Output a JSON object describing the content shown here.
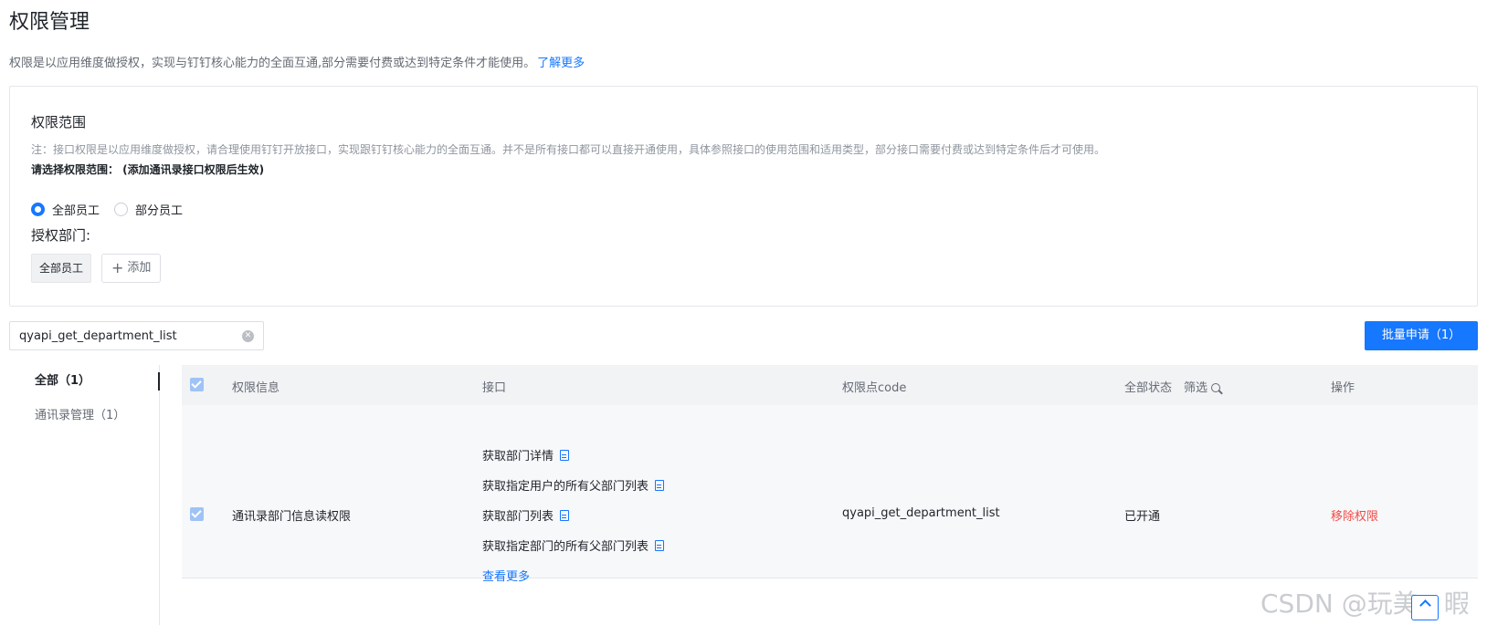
{
  "page": {
    "title": "权限管理",
    "intro": "权限是以应用维度做授权，实现与钉钉核心能力的全面互通,部分需要付费或达到特定条件才能使用。",
    "learn_more": "了解更多"
  },
  "scope": {
    "title": "权限范围",
    "note": "注：接口权限是以应用维度做授权，请合理使用钉钉开放接口，实现跟钉钉核心能力的全面互通。并不是所有接口都可以直接开通使用，具体参照接口的使用范围和适用类型，部分接口需要付费或达到特定条件后才可使用。",
    "select_label": "请选择权限范围： (添加通讯录接口权限后生效)",
    "options": [
      {
        "label": "全部员工",
        "checked": true
      },
      {
        "label": "部分员工",
        "checked": false
      }
    ],
    "dept_label": "授权部门:",
    "dept_tag": "全部员工",
    "add_label": "添加"
  },
  "search": {
    "value": "qyapi_get_department_list",
    "placeholder": ""
  },
  "batch_button": "批量申请（1）",
  "side_nav": [
    {
      "label": "全部（1）",
      "active": true
    },
    {
      "label": "通讯录管理（1）",
      "active": false
    }
  ],
  "table": {
    "headers": {
      "info": "权限信息",
      "api": "接口",
      "code": "权限点code",
      "status": "全部状态",
      "filter": "筛选",
      "action": "操作"
    },
    "rows": [
      {
        "name": "通讯录部门信息读权限",
        "apis": [
          "获取部门详情",
          "获取指定用户的所有父部门列表",
          "获取部门列表",
          "获取指定部门的所有父部门列表"
        ],
        "more": "查看更多",
        "code": "qyapi_get_department_list",
        "status": "已开通",
        "action": "移除权限"
      }
    ]
  },
  "watermark": "CSDN @玩美丶暇",
  "colors": {
    "primary": "#1677ff",
    "danger": "#f54a45",
    "text": "#1f2329",
    "muted": "#646a73"
  }
}
